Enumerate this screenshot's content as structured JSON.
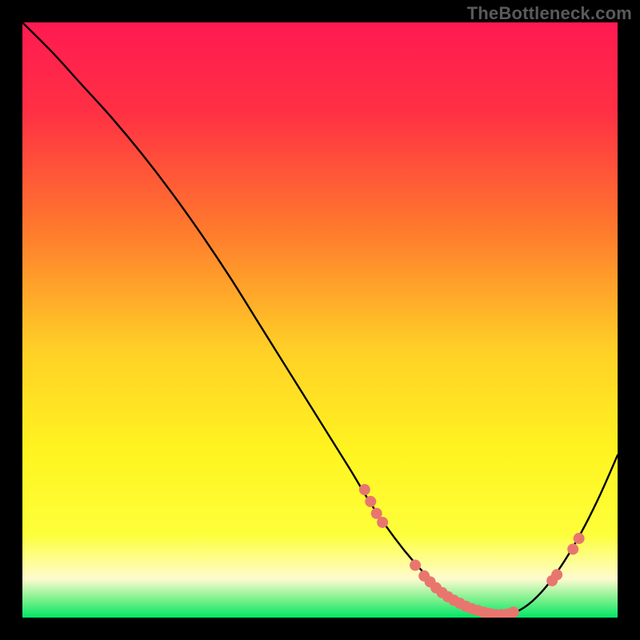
{
  "attribution": "TheBottleneck.com",
  "chart_data": {
    "type": "line",
    "title": "",
    "xlabel": "",
    "ylabel": "",
    "xlim": [
      0,
      100
    ],
    "ylim": [
      0,
      100
    ],
    "gradient_stops": [
      {
        "offset": 0.0,
        "color": "#ff1a52"
      },
      {
        "offset": 0.15,
        "color": "#ff3044"
      },
      {
        "offset": 0.35,
        "color": "#ff7a2d"
      },
      {
        "offset": 0.55,
        "color": "#ffd027"
      },
      {
        "offset": 0.72,
        "color": "#fff420"
      },
      {
        "offset": 0.86,
        "color": "#fdff3a"
      },
      {
        "offset": 0.935,
        "color": "#fefccf"
      },
      {
        "offset": 0.97,
        "color": "#7af08c"
      },
      {
        "offset": 1.0,
        "color": "#00e765"
      }
    ],
    "series": [
      {
        "name": "bottleneck-curve",
        "x": [
          0,
          5,
          10,
          15,
          20,
          25,
          30,
          35,
          40,
          45,
          50,
          55,
          58,
          61,
          64,
          67,
          70,
          73,
          76,
          79,
          82,
          85,
          88,
          91,
          94,
          97,
          100
        ],
        "y": [
          100,
          95,
          89.5,
          84,
          78,
          71.5,
          64.5,
          57,
          49,
          41,
          33,
          25,
          20,
          15.5,
          11.5,
          8,
          5,
          2.8,
          1.3,
          0.5,
          0.6,
          2.2,
          5.2,
          9.4,
          14.5,
          20.5,
          27.3
        ]
      }
    ],
    "markers": {
      "name": "highlight-points",
      "color": "#e8766f",
      "radius": 7,
      "points": [
        {
          "x": 57.5,
          "y": 21.5
        },
        {
          "x": 58.5,
          "y": 19.5
        },
        {
          "x": 59.5,
          "y": 17.5
        },
        {
          "x": 60.5,
          "y": 16.0
        },
        {
          "x": 66.0,
          "y": 8.8
        },
        {
          "x": 67.5,
          "y": 7.0
        },
        {
          "x": 68.5,
          "y": 6.0
        },
        {
          "x": 69.5,
          "y": 5.0
        },
        {
          "x": 70.5,
          "y": 4.2
        },
        {
          "x": 71.5,
          "y": 3.5
        },
        {
          "x": 72.5,
          "y": 2.9
        },
        {
          "x": 73.5,
          "y": 2.4
        },
        {
          "x": 74.5,
          "y": 1.9
        },
        {
          "x": 75.5,
          "y": 1.5
        },
        {
          "x": 76.5,
          "y": 1.2
        },
        {
          "x": 77.5,
          "y": 0.9
        },
        {
          "x": 78.5,
          "y": 0.7
        },
        {
          "x": 79.5,
          "y": 0.5
        },
        {
          "x": 80.5,
          "y": 0.5
        },
        {
          "x": 81.5,
          "y": 0.6
        },
        {
          "x": 82.5,
          "y": 0.9
        },
        {
          "x": 89.0,
          "y": 6.2
        },
        {
          "x": 89.8,
          "y": 7.2
        },
        {
          "x": 92.5,
          "y": 11.5
        },
        {
          "x": 93.5,
          "y": 13.3
        }
      ]
    }
  }
}
